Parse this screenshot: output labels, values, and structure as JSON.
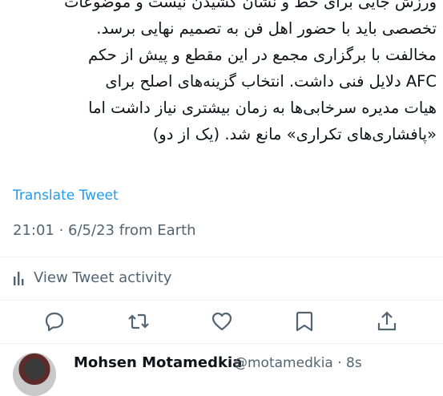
{
  "tweet": {
    "lines": [
      "ورزش جایی برای خط و نشان کشیدن نیست و موضوعات",
      "تخصصی باید با حضور اهل فن به تصمیم نهایی برسد.",
      "مخالفت با برگزاری مجمع در این مقطع و پیش از حکم",
      "AFC دلایل فنی داشت. انتخاب گزینه‌های اصلح برای",
      "هیات مدیره سرخابی‌ها به زمان بیشتری نیاز داشت اما",
      "«پافشاری‌های تکراری» مانع شد. (یک از دو)"
    ],
    "translate_label": "Translate Tweet",
    "timestamp": "21:01 · 6/5/23 from Earth",
    "activity_label": "View Tweet activity"
  },
  "actions": {
    "icons": [
      "reply-icon",
      "retweet-icon",
      "like-icon",
      "bookmark-icon",
      "share-icon"
    ]
  },
  "reply": {
    "name": "Mohsen Motamedkia",
    "handle": "@motamedkia · 8s"
  },
  "colors": {
    "link": "#1d9bf0",
    "secondary": "#536471",
    "text": "#0f1419"
  }
}
